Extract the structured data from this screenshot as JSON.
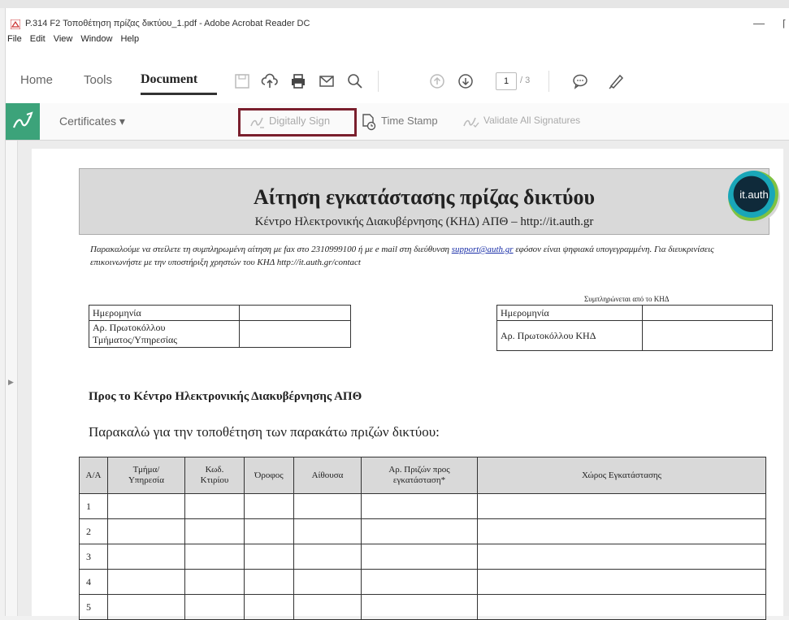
{
  "window": {
    "title": "P.314 F2 Τοποθέτηση πρίζας δικτύου_1.pdf - Adobe Acrobat Reader DC"
  },
  "menu": {
    "file": "File",
    "edit": "Edit",
    "view": "View",
    "window": "Window",
    "help": "Help"
  },
  "tabs": {
    "home": "Home",
    "tools": "Tools",
    "document": "Document"
  },
  "toolbar": {
    "current_page": "1",
    "total_pages": "/ 3"
  },
  "subtoolbar": {
    "certificates": "Certificates ▾",
    "digitally_sign": "Digitally Sign",
    "time_stamp": "Time Stamp",
    "validate_all": "Validate All Signatures"
  },
  "document": {
    "title": "Αίτηση εγκατάστασης πρίζας δικτύου",
    "subtitle": "Κέντρο Ηλεκτρονικής Διακυβέρνησης (ΚΗΔ) ΑΠΘ – http://it.auth.gr",
    "logo_text": "it.auth",
    "notice_before": "Παρακαλούμε να στείλετε τη συμπληρωμένη αίτηση με fax στο 2310999100 ή με e mail στη διεύθυνση ",
    "notice_email": "support@auth.gr",
    "notice_after": " εφόσον είναι ψηφιακά υπογεγραμμένη. Για διευκρινίσεις επικοινωνήστε με την υποστήριξη χρηστών του ΚΗΔ http://it.auth.gr/contact",
    "filled_by_note": "Συμπληρώνεται από το ΚΗΔ",
    "left_table": {
      "date": "Ημερομηνία",
      "protocol_line1": "Αρ. Πρωτοκόλλου",
      "protocol_line2": "Τμήματος/Υπηρεσίας"
    },
    "right_table": {
      "date": "Ημερομηνία",
      "protocol": "Αρ. Πρωτοκόλλου ΚΗΔ"
    },
    "to_heading": "Προς το Κέντρο Ηλεκτρονικής Διακυβέρνησης ΑΠΘ",
    "request_text": "Παρακαλώ για την τοποθέτηση των παρακάτω πριζών δικτύου:",
    "columns": {
      "aa": "Α/Α",
      "dept_line1": "Τμήμα/",
      "dept_line2": "Υπηρεσία",
      "building_line1": "Κωδ.",
      "building_line2": "Κτιρίου",
      "floor": "Όροφος",
      "room": "Αίθουσα",
      "outlets_line1": "Αρ. Πριζών προς",
      "outlets_line2": "εγκατάσταση*",
      "location": "Χώρος Εγκατάστασης"
    },
    "rows": [
      "1",
      "2",
      "3",
      "4",
      "5"
    ]
  }
}
